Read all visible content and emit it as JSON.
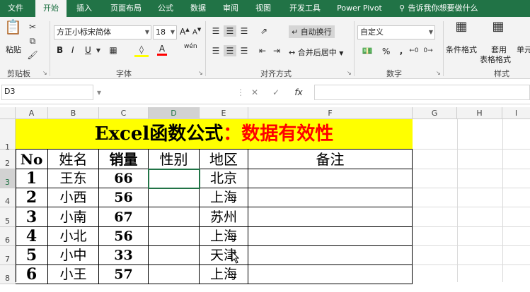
{
  "tabs": [
    "文件",
    "开始",
    "插入",
    "页面布局",
    "公式",
    "数据",
    "审阅",
    "视图",
    "开发工具",
    "Power Pivot"
  ],
  "tell_me": "告诉我你想要做什么",
  "clipboard": {
    "paste": "粘贴",
    "group": "剪贴板"
  },
  "font": {
    "name": "方正小标宋简体",
    "size": "18",
    "group": "字体",
    "font_increase": "A",
    "font_decrease": "A",
    "bold": "B",
    "italic": "I",
    "underline": "U",
    "font_color": "A",
    "phonetic": "wén"
  },
  "alignment": {
    "wrap": "自动换行",
    "merge": "合并后居中",
    "group": "对齐方式"
  },
  "number": {
    "format": "自定义",
    "group": "数字",
    "percent": "%"
  },
  "styles": {
    "conditional": "条件格式",
    "table_format_1": "套用",
    "table_format_2": "表格格式",
    "cell_styles": "单元",
    "group": "样式"
  },
  "formula_bar": {
    "name_box": "D3",
    "fx": "fx",
    "cancel": "✕",
    "enter": "✓"
  },
  "columns": [
    "A",
    "B",
    "C",
    "D",
    "E",
    "F",
    "G",
    "H",
    "I"
  ],
  "rows": [
    "1",
    "2",
    "3",
    "4",
    "5",
    "6",
    "7",
    "8"
  ],
  "sheet": {
    "title_part1": "Excel函数公式",
    "title_part2": "：数据有效性",
    "headers": [
      "No",
      "姓名",
      "销量",
      "性别",
      "地区",
      "备注"
    ],
    "data": [
      [
        "1",
        "王东",
        "66",
        "",
        "北京",
        ""
      ],
      [
        "2",
        "小西",
        "56",
        "",
        "上海",
        ""
      ],
      [
        "3",
        "小南",
        "67",
        "",
        "苏州",
        ""
      ],
      [
        "4",
        "小北",
        "56",
        "",
        "上海",
        ""
      ],
      [
        "5",
        "小中",
        "33",
        "",
        "天津",
        ""
      ],
      [
        "6",
        "小王",
        "57",
        "",
        "上海",
        ""
      ]
    ]
  },
  "colors": {
    "accent": "#217346",
    "title_bg": "#ffff00",
    "title_red": "#ff0000"
  }
}
